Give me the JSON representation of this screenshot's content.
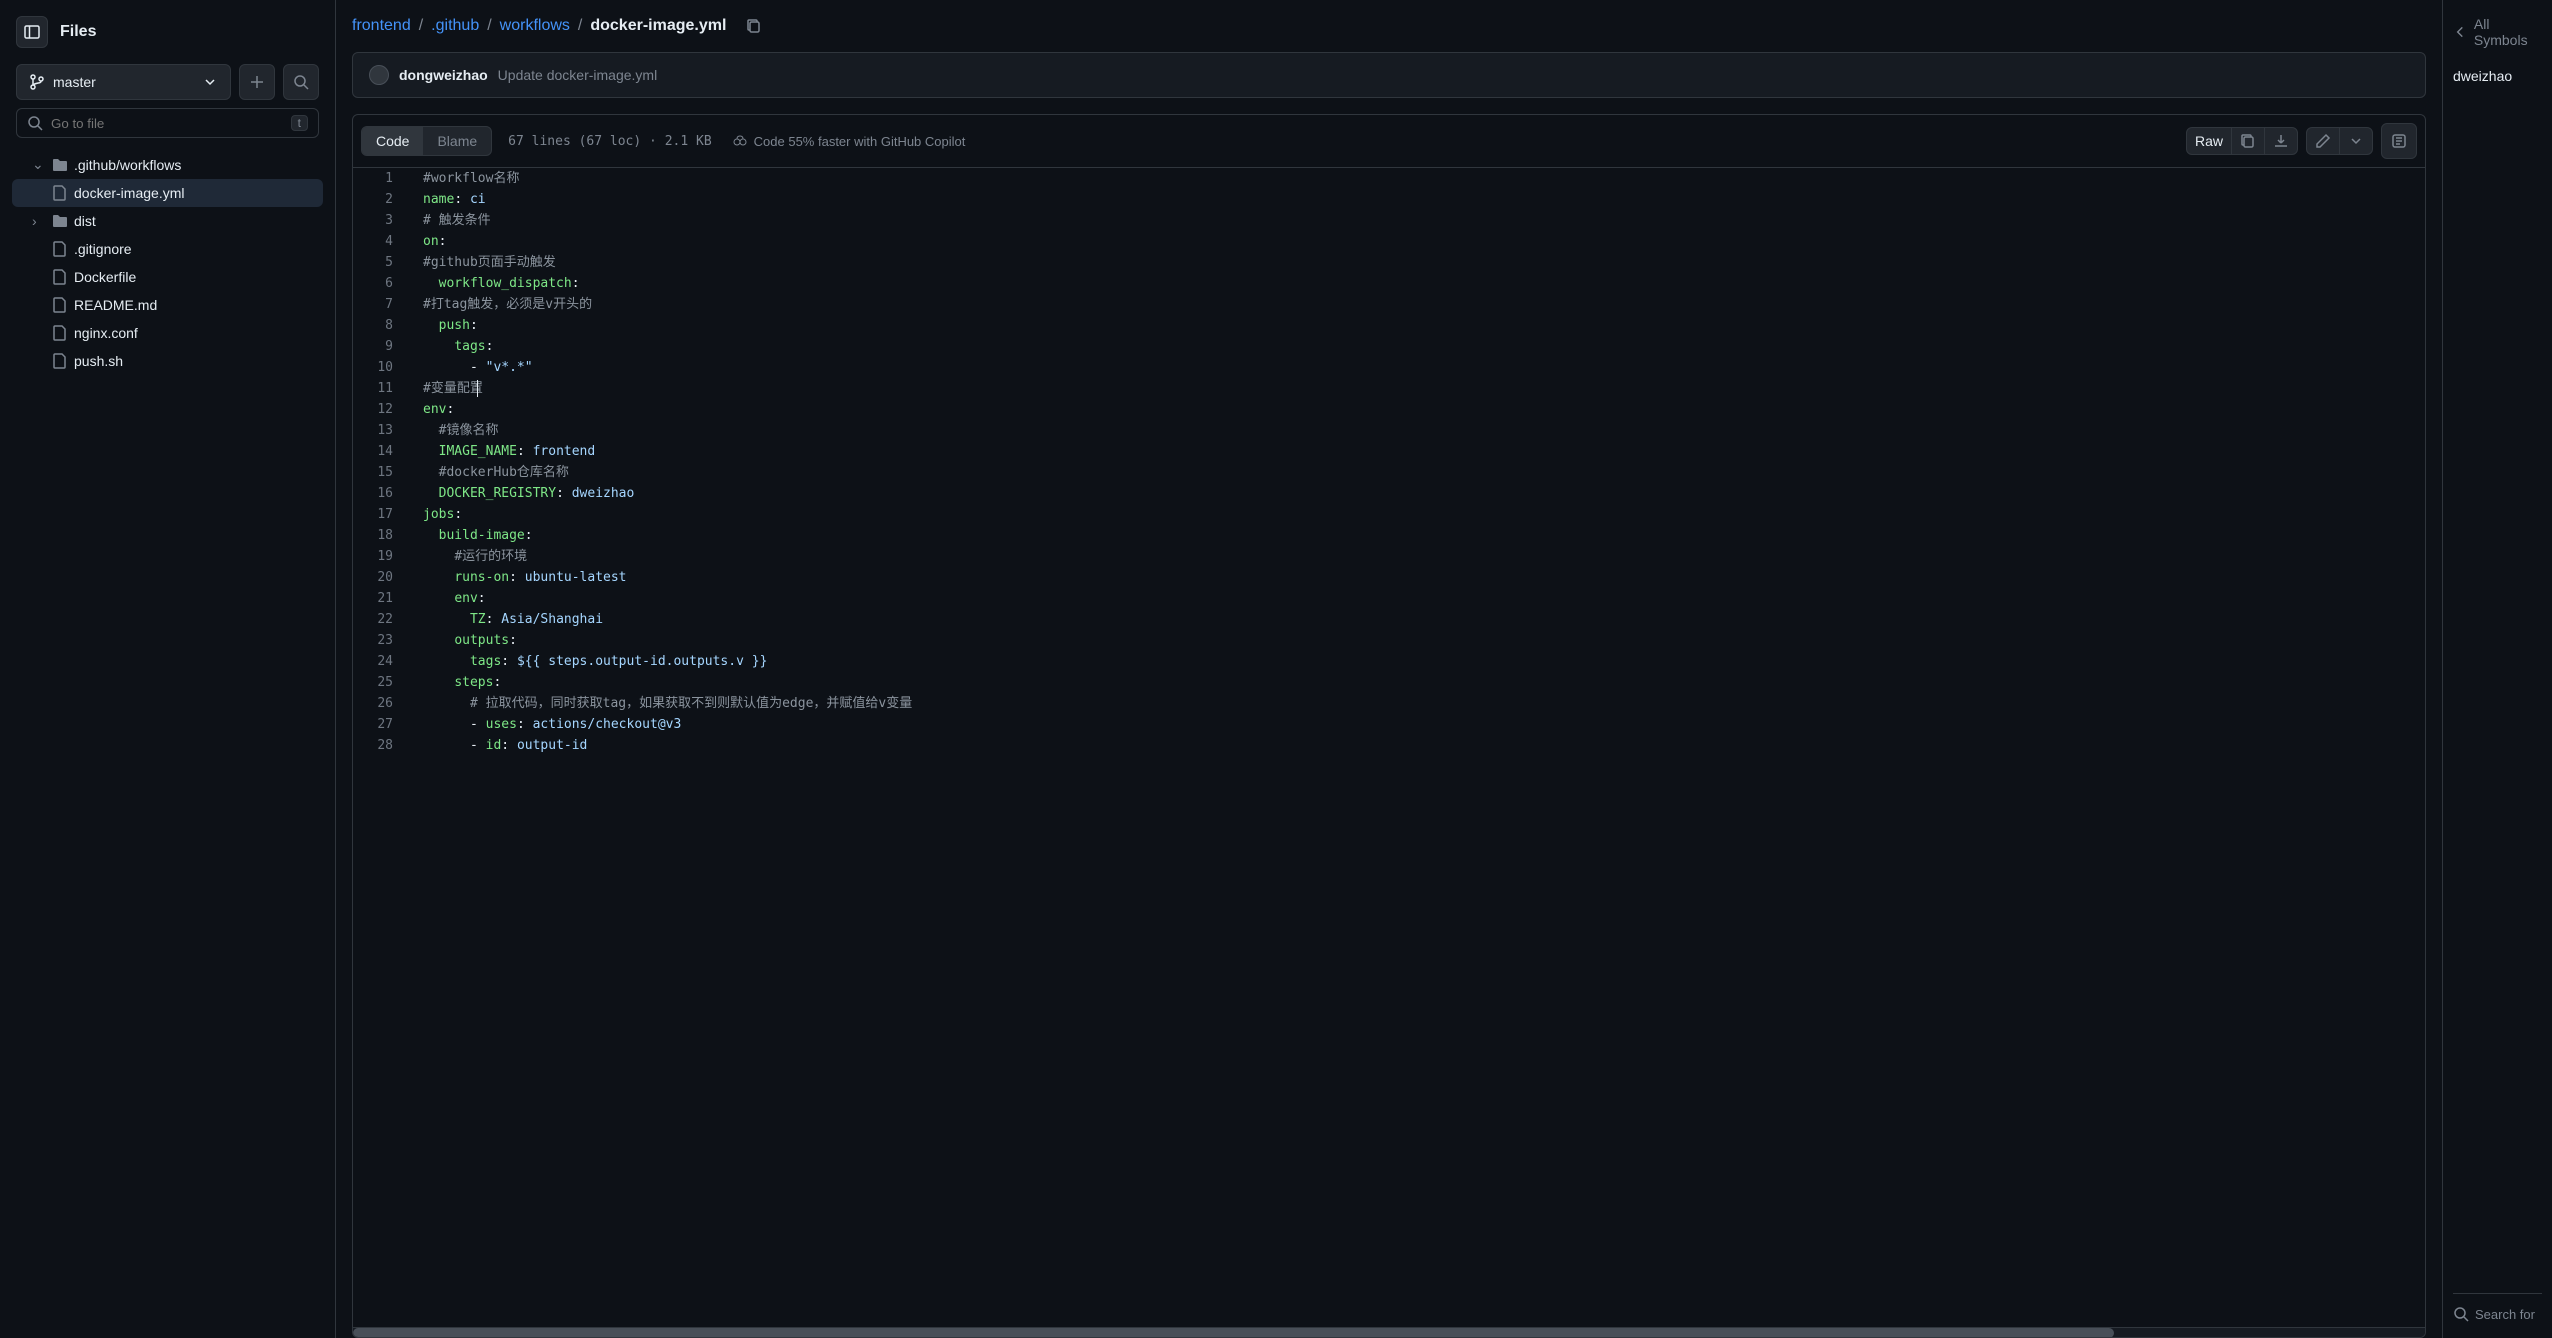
{
  "sidebar": {
    "title": "Files",
    "branch": "master",
    "search_placeholder": "Go to file",
    "search_key": "t",
    "tree": [
      {
        "type": "folder",
        "name": ".github/workflows",
        "open": true,
        "level": 0
      },
      {
        "type": "file",
        "name": "docker-image.yml",
        "level": 1,
        "active": true
      },
      {
        "type": "folder",
        "name": "dist",
        "open": false,
        "level": 0
      },
      {
        "type": "file",
        "name": ".gitignore",
        "level": 0
      },
      {
        "type": "file",
        "name": "Dockerfile",
        "level": 0
      },
      {
        "type": "file",
        "name": "README.md",
        "level": 0
      },
      {
        "type": "file",
        "name": "nginx.conf",
        "level": 0
      },
      {
        "type": "file",
        "name": "push.sh",
        "level": 0
      }
    ]
  },
  "breadcrumb": {
    "parts": [
      "frontend",
      ".github",
      "workflows"
    ],
    "current": "docker-image.yml"
  },
  "commit": {
    "author": "dongweizhao",
    "message": "Update docker-image.yml"
  },
  "tabs": {
    "code": "Code",
    "blame": "Blame"
  },
  "file_meta": "67 lines (67 loc) · 2.1 KB",
  "copilot_hint": "Code 55% faster with GitHub Copilot",
  "toolbar": {
    "raw": "Raw"
  },
  "code_lines": [
    {
      "n": 1,
      "segs": [
        {
          "t": "#workflow名称",
          "c": "c-comment"
        }
      ]
    },
    {
      "n": 2,
      "segs": [
        {
          "t": "name",
          "c": "c-key"
        },
        {
          "t": ": ",
          "c": "c-punct"
        },
        {
          "t": "ci",
          "c": "c-val"
        }
      ]
    },
    {
      "n": 3,
      "segs": [
        {
          "t": "# 触发条件",
          "c": "c-comment"
        }
      ]
    },
    {
      "n": 4,
      "segs": [
        {
          "t": "on",
          "c": "c-key"
        },
        {
          "t": ":",
          "c": "c-punct"
        }
      ]
    },
    {
      "n": 5,
      "segs": [
        {
          "t": "#github页面手动触发",
          "c": "c-comment"
        }
      ]
    },
    {
      "n": 6,
      "segs": [
        {
          "t": "  ",
          "c": ""
        },
        {
          "t": "workflow_dispatch",
          "c": "c-key"
        },
        {
          "t": ":",
          "c": "c-punct"
        }
      ]
    },
    {
      "n": 7,
      "segs": [
        {
          "t": "#打tag触发，必须是v开头的",
          "c": "c-comment"
        }
      ]
    },
    {
      "n": 8,
      "segs": [
        {
          "t": "  ",
          "c": ""
        },
        {
          "t": "push",
          "c": "c-key"
        },
        {
          "t": ":",
          "c": "c-punct"
        }
      ]
    },
    {
      "n": 9,
      "segs": [
        {
          "t": "    ",
          "c": ""
        },
        {
          "t": "tags",
          "c": "c-key"
        },
        {
          "t": ":",
          "c": "c-punct"
        }
      ]
    },
    {
      "n": 10,
      "segs": [
        {
          "t": "      - ",
          "c": "c-punct"
        },
        {
          "t": "\"v*.*\"",
          "c": "c-val"
        }
      ]
    },
    {
      "n": 11,
      "segs": [
        {
          "t": "#变量配置",
          "c": "c-comment"
        }
      ],
      "cursor": true
    },
    {
      "n": 12,
      "segs": [
        {
          "t": "env",
          "c": "c-key"
        },
        {
          "t": ":",
          "c": "c-punct"
        }
      ]
    },
    {
      "n": 13,
      "segs": [
        {
          "t": "  ",
          "c": ""
        },
        {
          "t": "#镜像名称",
          "c": "c-comment"
        }
      ]
    },
    {
      "n": 14,
      "segs": [
        {
          "t": "  ",
          "c": ""
        },
        {
          "t": "IMAGE_NAME",
          "c": "c-key"
        },
        {
          "t": ": ",
          "c": "c-punct"
        },
        {
          "t": "frontend",
          "c": "c-val"
        }
      ]
    },
    {
      "n": 15,
      "segs": [
        {
          "t": "  ",
          "c": ""
        },
        {
          "t": "#dockerHub仓库名称",
          "c": "c-comment"
        }
      ]
    },
    {
      "n": 16,
      "segs": [
        {
          "t": "  ",
          "c": ""
        },
        {
          "t": "DOCKER_REGISTRY",
          "c": "c-key"
        },
        {
          "t": ": ",
          "c": "c-punct"
        },
        {
          "t": "dweizhao",
          "c": "c-val"
        }
      ]
    },
    {
      "n": 17,
      "segs": [
        {
          "t": "jobs",
          "c": "c-key"
        },
        {
          "t": ":",
          "c": "c-punct"
        }
      ]
    },
    {
      "n": 18,
      "segs": [
        {
          "t": "  ",
          "c": ""
        },
        {
          "t": "build-image",
          "c": "c-key"
        },
        {
          "t": ":",
          "c": "c-punct"
        }
      ]
    },
    {
      "n": 19,
      "segs": [
        {
          "t": "    ",
          "c": ""
        },
        {
          "t": "#运行的环境",
          "c": "c-comment"
        }
      ]
    },
    {
      "n": 20,
      "segs": [
        {
          "t": "    ",
          "c": ""
        },
        {
          "t": "runs-on",
          "c": "c-key"
        },
        {
          "t": ": ",
          "c": "c-punct"
        },
        {
          "t": "ubuntu-latest",
          "c": "c-val"
        }
      ]
    },
    {
      "n": 21,
      "segs": [
        {
          "t": "    ",
          "c": ""
        },
        {
          "t": "env",
          "c": "c-key"
        },
        {
          "t": ":",
          "c": "c-punct"
        }
      ]
    },
    {
      "n": 22,
      "segs": [
        {
          "t": "      ",
          "c": ""
        },
        {
          "t": "TZ",
          "c": "c-key"
        },
        {
          "t": ": ",
          "c": "c-punct"
        },
        {
          "t": "Asia/Shanghai",
          "c": "c-val"
        }
      ]
    },
    {
      "n": 23,
      "segs": [
        {
          "t": "    ",
          "c": ""
        },
        {
          "t": "outputs",
          "c": "c-key"
        },
        {
          "t": ":",
          "c": "c-punct"
        }
      ]
    },
    {
      "n": 24,
      "segs": [
        {
          "t": "      ",
          "c": ""
        },
        {
          "t": "tags",
          "c": "c-key"
        },
        {
          "t": ": ",
          "c": "c-punct"
        },
        {
          "t": "${{ steps.output-id.outputs.v }}",
          "c": "c-val"
        }
      ]
    },
    {
      "n": 25,
      "segs": [
        {
          "t": "    ",
          "c": ""
        },
        {
          "t": "steps",
          "c": "c-key"
        },
        {
          "t": ":",
          "c": "c-punct"
        }
      ]
    },
    {
      "n": 26,
      "segs": [
        {
          "t": "      ",
          "c": ""
        },
        {
          "t": "# 拉取代码，同时获取tag，如果获取不到则默认值为edge，并赋值给v变量",
          "c": "c-comment"
        }
      ]
    },
    {
      "n": 27,
      "segs": [
        {
          "t": "      - ",
          "c": "c-punct"
        },
        {
          "t": "uses",
          "c": "c-key"
        },
        {
          "t": ": ",
          "c": "c-punct"
        },
        {
          "t": "actions/checkout@v3",
          "c": "c-val"
        }
      ]
    },
    {
      "n": 28,
      "segs": [
        {
          "t": "      - ",
          "c": "c-punct"
        },
        {
          "t": "id",
          "c": "c-key"
        },
        {
          "t": ": ",
          "c": "c-punct"
        },
        {
          "t": "output-id",
          "c": "c-val"
        }
      ]
    }
  ],
  "right_panel": {
    "all_symbols": "All Symbols",
    "symbol": "dweizhao",
    "search": "Search for"
  }
}
